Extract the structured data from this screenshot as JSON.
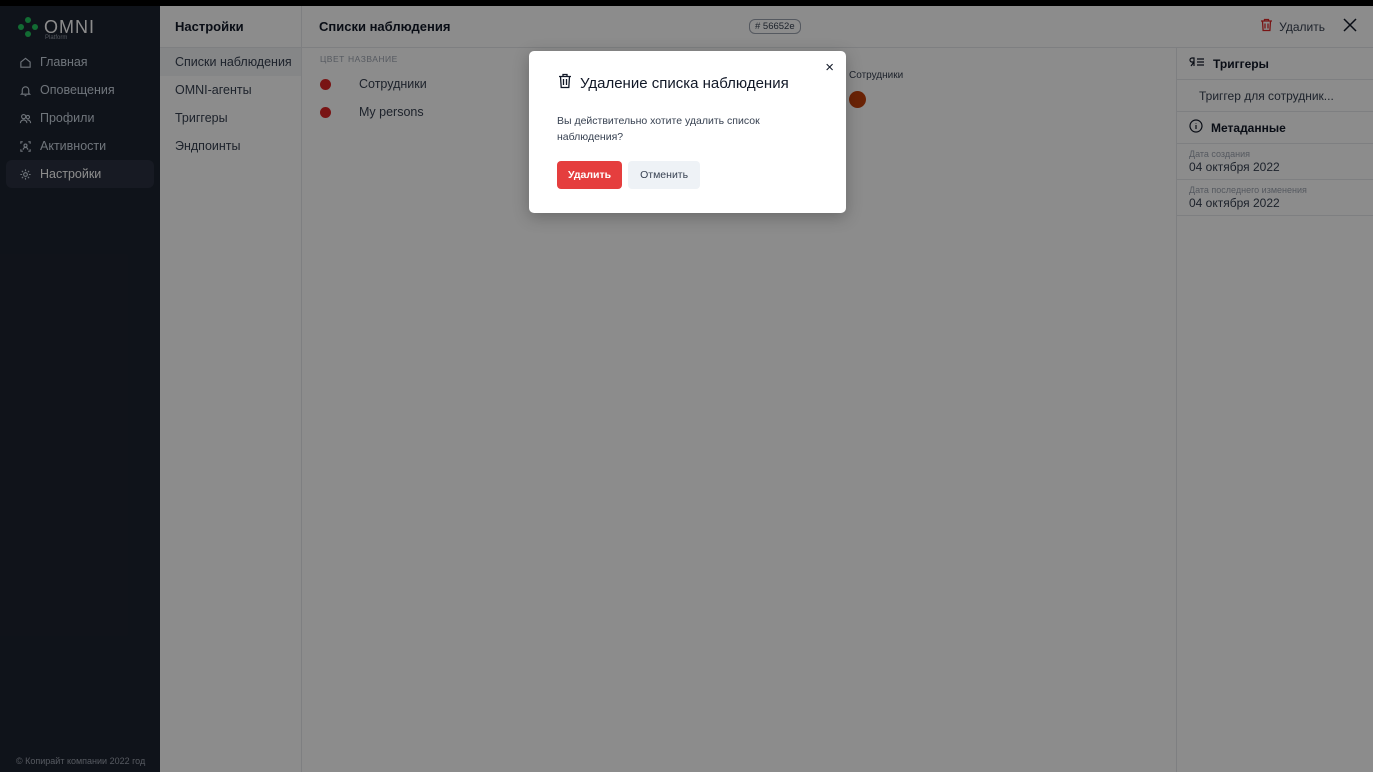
{
  "sidebar": {
    "logo_text": "OMNI",
    "logo_sub": "Platform",
    "items": [
      {
        "label": "Главная",
        "icon": "home-icon"
      },
      {
        "label": "Оповещения",
        "icon": "bell-icon"
      },
      {
        "label": "Профили",
        "icon": "users-icon"
      },
      {
        "label": "Активности",
        "icon": "activity-icon"
      },
      {
        "label": "Настройки",
        "icon": "gear-icon"
      }
    ],
    "footer": "© Копирайт компании 2022 год"
  },
  "settings": {
    "title": "Настройки",
    "items": [
      "Списки наблюдения",
      "OMNI-агенты",
      "Триггеры",
      "Эндпоинты"
    ]
  },
  "watchlists": {
    "title": "Списки наблюдения",
    "col_color": "ЦВЕТ",
    "col_name": "НАЗВАНИЕ",
    "rows": [
      {
        "name": "Сотрудники",
        "color": "#dc2626"
      },
      {
        "name": "My persons",
        "color": "#dc2626"
      }
    ]
  },
  "detail": {
    "hash": "# 56652e",
    "delete_label": "Удалить",
    "close_icon": "close-icon",
    "name": "Сотрудники",
    "color": "#c2410c",
    "triggers_title": "Триггеры",
    "trigger_item": "Триггер для сотрудник...",
    "metadata_title": "Метаданные",
    "created_label": "Дата создания",
    "created_value": "04 октября 2022",
    "modified_label": "Дата последнего изменения",
    "modified_value": "04 октября 2022"
  },
  "modal": {
    "title": "Удаление списка наблюдения",
    "text": "Вы действительно хотите удалить список наблюдения?",
    "confirm_label": "Удалить",
    "cancel_label": "Отменить",
    "close_glyph": "×"
  }
}
